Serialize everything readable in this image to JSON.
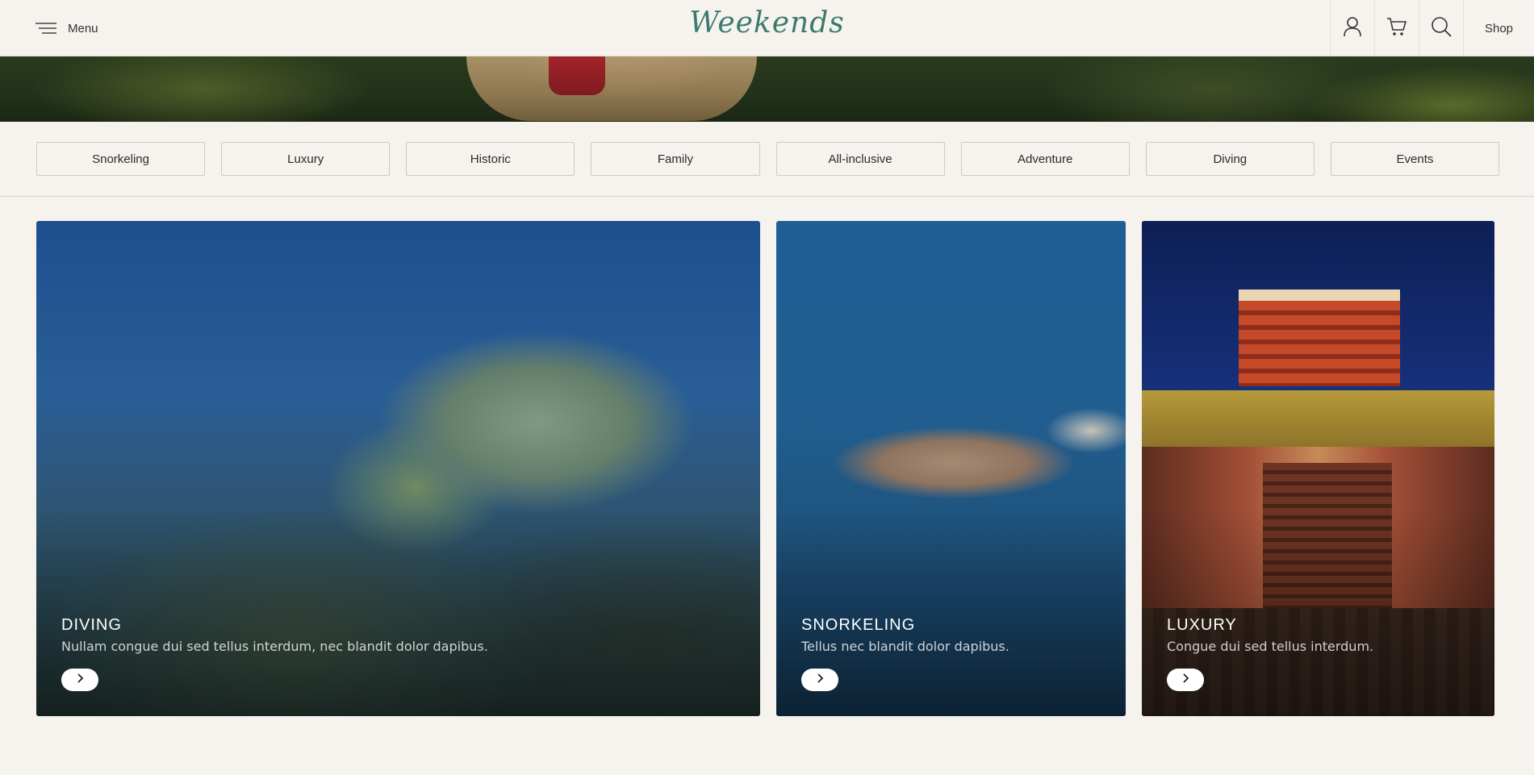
{
  "header": {
    "menu_label": "Menu",
    "logo": "Weekends",
    "shop_label": "Shop",
    "icons": [
      "user-icon",
      "cart-icon",
      "search-icon"
    ]
  },
  "tags": [
    {
      "label": "Snorkeling"
    },
    {
      "label": "Luxury"
    },
    {
      "label": "Historic"
    },
    {
      "label": "Family"
    },
    {
      "label": "All-inclusive"
    },
    {
      "label": "Adventure"
    },
    {
      "label": "Diving"
    },
    {
      "label": "Events"
    }
  ],
  "cards": [
    {
      "title": "DIVING",
      "description": "Nullam congue dui sed tellus interdum, nec blandit dolor dapibus."
    },
    {
      "title": "SNORKELING",
      "description": "Tellus nec blandit dolor dapibus."
    },
    {
      "title": "LUXURY",
      "description": "Congue dui sed tellus interdum."
    }
  ],
  "colors": {
    "background": "#f6f3ee",
    "logo": "#3c7a6e",
    "border": "#cfcbc3"
  }
}
